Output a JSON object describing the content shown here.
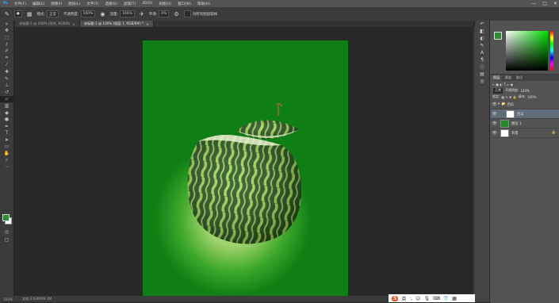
{
  "menu": [
    "文件(F)",
    "编辑(E)",
    "图像(I)",
    "图层(L)",
    "文字(Y)",
    "选择(S)",
    "滤镜(T)",
    "3D(D)",
    "视图(V)",
    "窗口(W)",
    "帮助(H)"
  ],
  "window_controls": [
    "—",
    "□",
    "✕"
  ],
  "options": {
    "mode_label": "模式:",
    "mode_value": "正常",
    "opacity_label": "不透明度:",
    "opacity_value": "100%",
    "flow_label": "流量:",
    "flow_value": "100%",
    "smooth_label": "平滑:",
    "smooth_value": "0%",
    "checkbox_label": "对所有图层取样"
  },
  "tabs": [
    "未标题-1 @ 100% (形状, RGB/8)",
    "未标题-1 @ 100% (图层 1, RGB/8#) *"
  ],
  "statusbar": {
    "zoom": "100%",
    "doc": "文档:2.63M/49.3M"
  },
  "ime": {
    "logo": "S",
    "label": "英"
  },
  "colors": {
    "foreground": "#2e8b2e",
    "background": "#ffffff",
    "doc_dark": "#0e7f14",
    "doc_light": "#dff2c0"
  },
  "layers": {
    "tabs": [
      "图层",
      "通道",
      "路径"
    ],
    "blend_mode": "正常",
    "opacity_label": "不透明度:",
    "opacity_value": "100%",
    "lock_label": "锁定:",
    "fill_label": "填充:",
    "fill_value": "100%",
    "items": [
      {
        "name": "西瓜",
        "type": "group"
      },
      {
        "name": "西瓜",
        "type": "layer"
      },
      {
        "name": "图层 1",
        "type": "layer"
      },
      {
        "name": "背景",
        "type": "layer"
      }
    ]
  }
}
